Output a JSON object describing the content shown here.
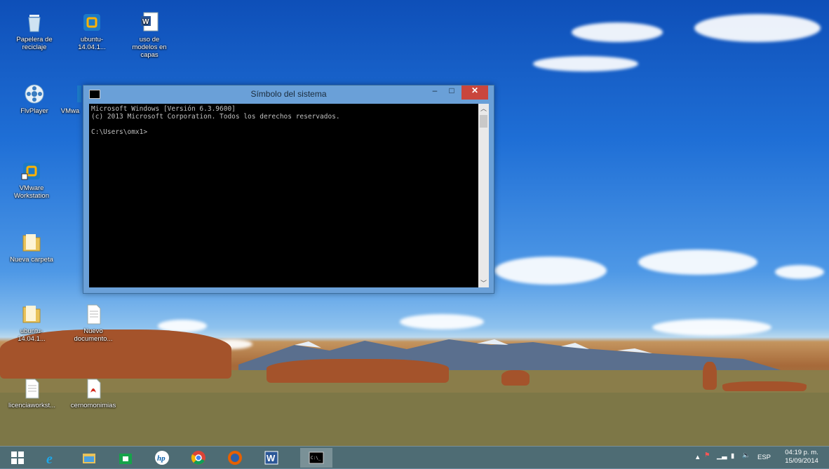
{
  "desktop": {
    "icons": [
      {
        "label": "Papelera de reciclaje",
        "icon": "recycle-bin-icon"
      },
      {
        "label": "ubuntu-14.04.1...",
        "icon": "vmware-vm-icon"
      },
      {
        "label": "uso de modelos en capas",
        "icon": "word-document-icon"
      },
      {
        "label": "FlvPlayer",
        "icon": "flv-player-icon"
      },
      {
        "label": "VMwa",
        "icon": "vmware-icon"
      },
      {
        "label": "VMware Workstation",
        "icon": "vmware-workstation-icon"
      },
      {
        "label": "Nueva carpeta",
        "icon": "folder-icon"
      },
      {
        "label": "ubuntu-14.04.1...",
        "icon": "folder-icon"
      },
      {
        "label": "Nuevo documento...",
        "icon": "text-document-icon"
      },
      {
        "label": "licenciaworkst...",
        "icon": "text-document-icon"
      },
      {
        "label": "cernomonimias",
        "icon": "pdf-document-icon"
      }
    ]
  },
  "cmd": {
    "title": "Símbolo del sistema",
    "lines": [
      "Microsoft Windows [Versión 6.3.9600]",
      "(c) 2013 Microsoft Corporation. Todos los derechos reservados.",
      "",
      "C:\\Users\\omx1>"
    ],
    "minimize": "–",
    "maximize": "□",
    "close": "✕"
  },
  "taskbar": {
    "items": [
      {
        "icon": "windows-start-icon"
      },
      {
        "icon": "internet-explorer-icon"
      },
      {
        "icon": "file-explorer-icon"
      },
      {
        "icon": "windows-store-icon"
      },
      {
        "icon": "hp-icon"
      },
      {
        "icon": "chrome-icon"
      },
      {
        "icon": "firefox-icon"
      },
      {
        "icon": "word-icon"
      },
      {
        "icon": "command-prompt-icon"
      }
    ],
    "tray": {
      "language": "ESP",
      "time": "04:19 p. m.",
      "date": "15/09/2014"
    }
  },
  "colors": {
    "sky_top": "#0e4fb8",
    "window_frame": "#6aa0d8",
    "close_button": "#c9463d",
    "console_bg": "#000000",
    "console_text": "#c0c0c0",
    "taskbar": "#416982"
  }
}
